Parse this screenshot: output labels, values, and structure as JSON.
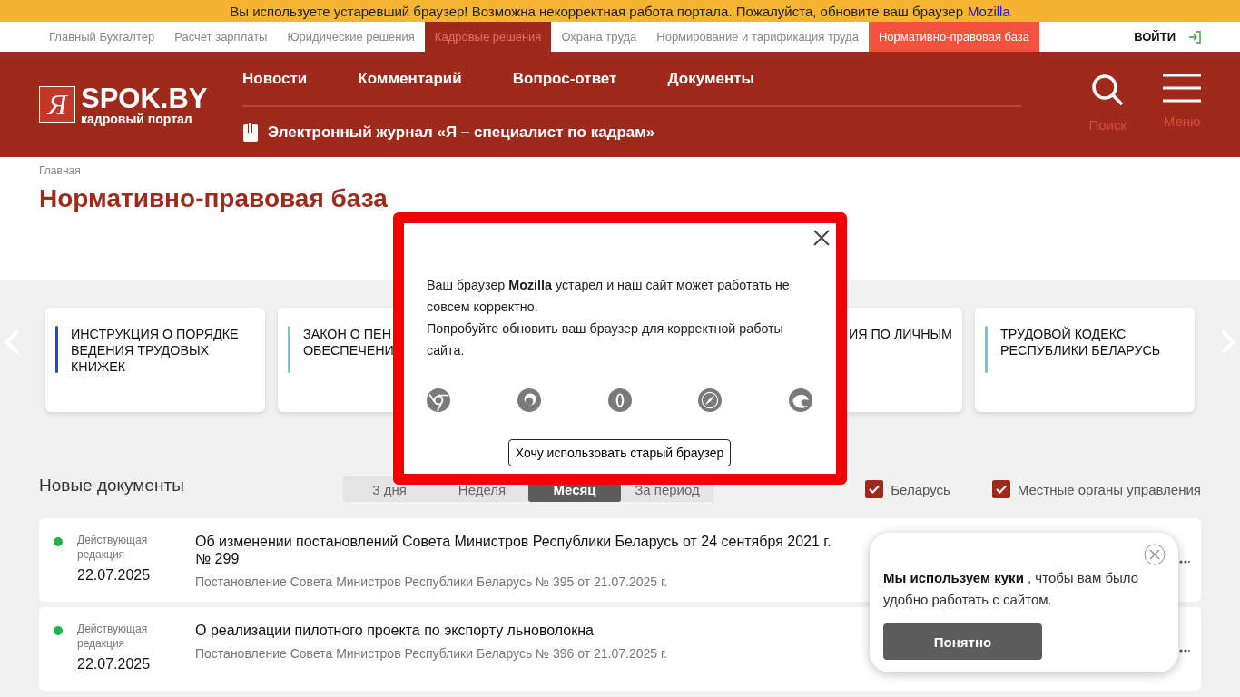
{
  "warning_bar": {
    "text": "Вы используете устаревший браузер! Возможна некорректная работа портала. Пожалуйста, обновите ваш браузер",
    "link": "Mozilla"
  },
  "portal_nav": {
    "items": [
      {
        "label": "Главный Бухгалтер",
        "kind": "plain"
      },
      {
        "label": "Расчет зарплаты",
        "kind": "plain"
      },
      {
        "label": "Юридические решения",
        "kind": "plain"
      },
      {
        "label": "Кадровые решения",
        "kind": "current"
      },
      {
        "label": "Охрана труда",
        "kind": "plain"
      },
      {
        "label": "Нормирование и тарификация труда",
        "kind": "plain"
      },
      {
        "label": "Нормативно-правовая база",
        "kind": "accent"
      }
    ],
    "login": "ВОЙТИ"
  },
  "header": {
    "logo_mark": "Я",
    "logo_title": "SPOK.BY",
    "logo_subtitle": "кадровый портал",
    "menu": [
      "Новости",
      "Комментарий",
      "Вопрос-ответ",
      "Документы"
    ],
    "journal": "Электронный журнал «Я – специалист по кадрам»",
    "search_label": "Поиск",
    "menu_label": "Меню"
  },
  "breadcrumb": "Главная",
  "page_title": "Нормативно-правовая база",
  "cards": [
    {
      "lines": [
        "ИНСТРУКЦИЯ О ПОРЯДКЕ",
        "ВЕДЕНИЯ ТРУДОВЫХ",
        "КНИЖЕК"
      ],
      "color": "#1f4fbf",
      "kind": "full"
    },
    {
      "lines": [
        "ЗАКОН О ПЕН",
        "ОБЕСПЕЧЕНИ"
      ],
      "color": "#7cc0e0",
      "kind": "full"
    },
    {
      "lines": [
        "ИЯ ПО ЛИЧНЫМ"
      ],
      "kind": "clipped"
    },
    {
      "lines": [
        "ТРУДОВОЙ КОДЕКС",
        "РЕСПУБЛИКИ БЕЛАРУСЬ"
      ],
      "color": "#7cc0e0",
      "kind": "full"
    }
  ],
  "new_docs": {
    "title": "Новые документы",
    "periods": [
      {
        "label": "3 дня",
        "selected": false
      },
      {
        "label": "Неделя",
        "selected": false
      },
      {
        "label": "Месяц",
        "selected": true
      },
      {
        "label": "За период",
        "selected": false
      }
    ],
    "filters": [
      {
        "label": "Беларусь",
        "checked": true
      },
      {
        "label": "Местные органы управления",
        "checked": true
      }
    ],
    "rows": [
      {
        "status": "Действующая редакция",
        "color": "#22b24c",
        "date": "22.07.2025",
        "title": "Об изменении постановлений Совета Министров Республики Беларусь от 24 сентября 2021 г. № 299",
        "source": "Постановление Совета Министров Республики Беларусь № 395 от 21.07.2025 г."
      },
      {
        "status": "Действующая редакция",
        "color": "#22b24c",
        "date": "22.07.2025",
        "title": "О реализации пилотного проекта по экспорту льноволокна",
        "source": "Постановление Совета Министров Республики Беларусь № 396 от 21.07.2025 г."
      }
    ]
  },
  "browser_dialog": {
    "paragraphs": [
      "Ваш браузер **Mozilla** устарел и наш сайт может работать не совсем корректно.",
      "Попробуйте обновить ваш браузер для корректной работы сайта."
    ],
    "button": "Хочу использовать старый браузер"
  },
  "cookie_popup": {
    "link": "Мы используем куки",
    "text": " , чтобы вам было удобно работать с сайтом.",
    "button": "Понятно"
  }
}
